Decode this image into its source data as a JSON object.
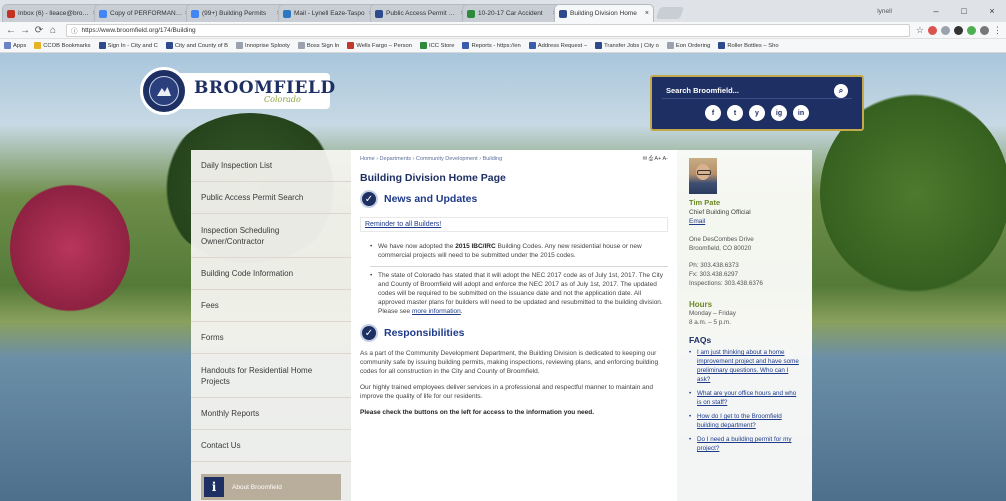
{
  "browser": {
    "tabs": [
      {
        "label": "Inbox (6) - lleace@broom",
        "color": "#c23321"
      },
      {
        "label": "Copy of PERFORMANCE",
        "color": "#4285f4"
      },
      {
        "label": "(99+) Building Permits",
        "color": "#4285f4"
      },
      {
        "label": "Mail - Lynell Eaze-Taspo",
        "color": "#2b79c2"
      },
      {
        "label": "Public Access Permit Sea",
        "color": "#2d4b8c"
      },
      {
        "label": "10-20-17 Car Accident",
        "color": "#2d8a3a"
      },
      {
        "label": "Building Division Home",
        "color": "#2d4b8c"
      }
    ],
    "active_tab": 6,
    "user": "lynell",
    "window_controls": [
      "–",
      "□",
      "×"
    ],
    "url": "https://www.broomfield.org/174/Building",
    "bookmarks": [
      {
        "label": "Apps",
        "color": "#6a83c4"
      },
      {
        "label": "CCOB Bookmarks",
        "color": "#e6b422"
      },
      {
        "label": "Sign In - City and C",
        "color": "#2d4b8c"
      },
      {
        "label": "City and County of B",
        "color": "#2d4b8c"
      },
      {
        "label": "Innoprise Splooty",
        "color": "#9aa3ad"
      },
      {
        "label": "Boss Sign In",
        "color": "#9aa3ad"
      },
      {
        "label": "Wells Fargo – Person",
        "color": "#c0392b"
      },
      {
        "label": "ICC Store",
        "color": "#2d8a3a"
      },
      {
        "label": "Reports - https://en",
        "color": "#3b5bab"
      },
      {
        "label": "Address Request – ",
        "color": "#3b5bab"
      },
      {
        "label": "Transfer Jobs | City o",
        "color": "#2d4b8c"
      },
      {
        "label": "Eon Ordering",
        "color": "#9aa3ad"
      },
      {
        "label": "Roller Bottles – Sho",
        "color": "#2d4b8c"
      }
    ]
  },
  "site": {
    "logo_main": "BROOMFIELD",
    "logo_sub": "Colorado",
    "search_label": "Search Broomfield...",
    "search_go": "Q",
    "social": [
      "f",
      "t",
      "y",
      "ig",
      "in"
    ]
  },
  "sidebar": {
    "items": [
      "Daily Inspection List",
      "Public Access Permit Search",
      "Inspection Scheduling Owner/Contractor",
      "Building Code Information",
      "Fees",
      "Forms",
      "Handouts for Residential Home Projects",
      "Monthly Reports",
      "Contact Us"
    ],
    "feature_label": "About Broomfield",
    "feature_icon": "i"
  },
  "main": {
    "breadcrumb": "Home › Departments › Community Development › Building",
    "tools": "✉ ⎙  A+ A-",
    "title": "Building Division Home Page",
    "news_heading": "News and Updates",
    "reminder": "Reminder to all Builders!",
    "bullet1_pre": "We have now adopted the ",
    "bullet1_bold": "2015 IBC/IRC",
    "bullet1_post": " Building Codes. Any new residential house or new commercial projects will need to be submitted under the 2015 codes.",
    "bullet2_pre": "The state of Colorado has stated that it will adopt the NEC 2017 code as of July 1st, 2017. The City and County of Broomfield will adopt and enforce the NEC 2017 as of July 1st, 2017. The updated codes will be required to be submitted on the issuance date and not the application date. All approved master plans for builders will need to be updated and resubmitted to the building division. Please see ",
    "bullet2_link": "more information",
    "bullet2_end": ".",
    "resp_heading": "Responsibilities",
    "resp_p1": "As a part of the Community Development Department, the Building Division is dedicated to keeping our community safe by issuing building permits, making inspections, reviewing plans, and enforcing building codes for all construction in the City and County of Broomfield.",
    "resp_p2": "Our highly trained employees deliver services in a professional and respectful manner to maintain and improve the quality of life for our residents.",
    "resp_p3": "Please check the buttons on the left for access to the information you need."
  },
  "contact": {
    "name": "Tim Pate",
    "title": "Chief Building Official",
    "email": "Email",
    "addr1": "One DesCombes Drive",
    "addr2": "Broomfield, CO 80020",
    "ph": "Ph: 303.438.6373",
    "fx": "Fx: 303.438.6297",
    "insp": "Inspections: 303.438.6376",
    "hours_h": "Hours",
    "hours1": "Monday – Friday",
    "hours2": "8 a.m. – 5 p.m.",
    "faqs_h": "FAQs",
    "faqs": [
      "I am just thinking about a home improvement project and have some preliminary questions. Who can I ask?",
      "What are your office hours and who is on staff?",
      "How do I get to the Broomfield building department?",
      "Do I need a building permit for my project?"
    ]
  }
}
